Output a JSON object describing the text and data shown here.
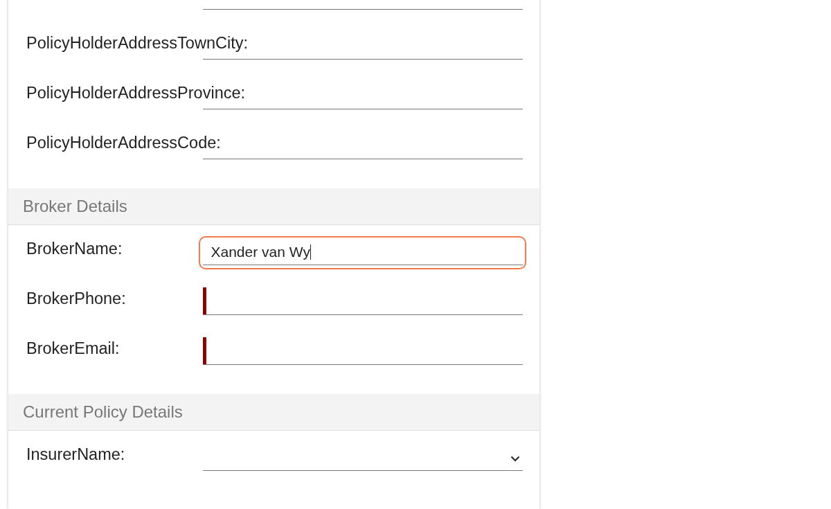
{
  "groups": [
    {
      "fields": [
        {
          "kind": "text",
          "required": false,
          "focused": false
        },
        {
          "label": "PolicyHolderAddressTownCity:",
          "kind": "text",
          "required": false,
          "focused": false
        },
        {
          "label": "PolicyHolderAddressProvince:",
          "kind": "text",
          "required": false,
          "focused": false
        },
        {
          "label": "PolicyHolderAddressCode:",
          "kind": "text",
          "required": false,
          "focused": false
        }
      ]
    },
    {
      "title": "Broker Details",
      "fields": [
        {
          "label": "BrokerName:",
          "kind": "text",
          "value": "Xander van Wy",
          "required": false,
          "focused": true
        },
        {
          "label": "BrokerPhone:",
          "kind": "text",
          "required": true,
          "focused": false
        },
        {
          "label": "BrokerEmail:",
          "kind": "text",
          "required": true,
          "focused": false
        }
      ]
    },
    {
      "title": "Current Policy Details",
      "fields": [
        {
          "label": "InsurerName:",
          "kind": "select",
          "required": false,
          "focused": false
        }
      ]
    }
  ]
}
